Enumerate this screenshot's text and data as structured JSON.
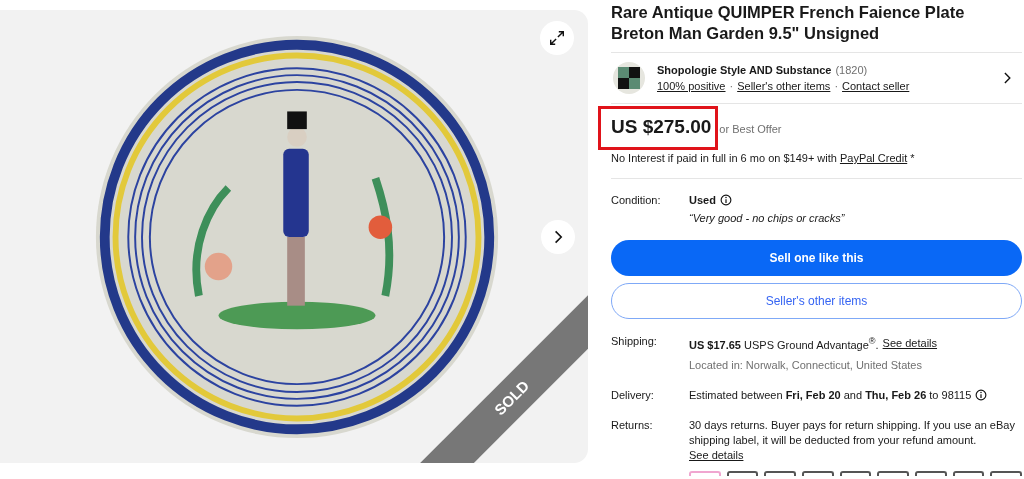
{
  "gallery": {
    "badge": "SOLD"
  },
  "title": "Rare Antique QUIMPER French Faience Plate Breton Man Garden 9.5\" Unsigned",
  "seller": {
    "name": "Shopologie Style AND Substance",
    "count": "(1820)",
    "links": [
      "100% positive",
      "Seller's other items",
      "Contact seller"
    ],
    "separator": "·"
  },
  "price": {
    "amount": "US $275.00",
    "suffix": "or Best Offer",
    "highlighted": true,
    "financing": "No Interest if paid in full in 6 mo on $149+ with",
    "financing_link": "PayPal Credit",
    "financing_mark": "*"
  },
  "condition": {
    "label": "Condition:",
    "value": "Used",
    "note": "“Very good - no chips or cracks”"
  },
  "buttons": [
    {
      "label": "Sell one like this",
      "kind": "primary"
    },
    {
      "label": "Seller's other items",
      "kind": "secondary"
    }
  ],
  "details": [
    {
      "label": "Shipping:",
      "text": "**US $17.65** USPS Ground Advantage$^{®}$.",
      "link": "See details",
      "sub": "Located in: Norwalk, Connecticut, United States",
      "info": false
    },
    {
      "label": "Delivery:",
      "text": "Estimated between **Fri, Feb 20** and **Thu, Feb 26** to 98115",
      "info": true
    },
    {
      "label": "Returns:",
      "text": "30 days returns. Buyer pays for return shipping. If you use an eBay shipping label, it will be deducted from your refund amount.",
      "link": "See details",
      "link_block": true,
      "info": false
    }
  ]
}
